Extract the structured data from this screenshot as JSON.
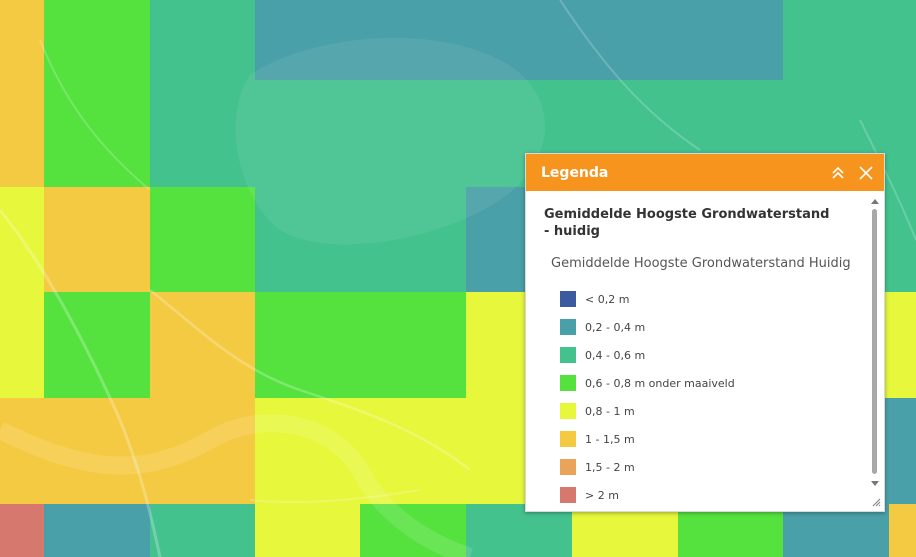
{
  "legend_panel": {
    "title": "Legenda",
    "layer_title": "Gemiddelde Hoogste Grondwaterstand - huidig",
    "sublayer_title": "Gemiddelde Hoogste Grondwaterstand Huidig",
    "items": [
      {
        "label": "< 0,2 m",
        "color": "#3d5aa0"
      },
      {
        "label": "0,2 - 0,4 m",
        "color": "#4aa0a8"
      },
      {
        "label": "0,4 - 0,6 m",
        "color": "#43c28e"
      },
      {
        "label": "0,6 - 0,8 m onder maaiveld",
        "color": "#55e23f"
      },
      {
        "label": "0,8 - 1 m",
        "color": "#e6f73c"
      },
      {
        "label": "1 - 1,5 m",
        "color": "#f5ca43"
      },
      {
        "label": "1,5 - 2 m",
        "color": "#eaa45a"
      },
      {
        "label": "> 2 m",
        "color": "#d7786f"
      }
    ],
    "collapse_icon": "double-chevron-up-icon",
    "close_icon": "close-icon",
    "resize_icon": "resize-handle-icon"
  },
  "map": {
    "accent": "#f7941d"
  }
}
